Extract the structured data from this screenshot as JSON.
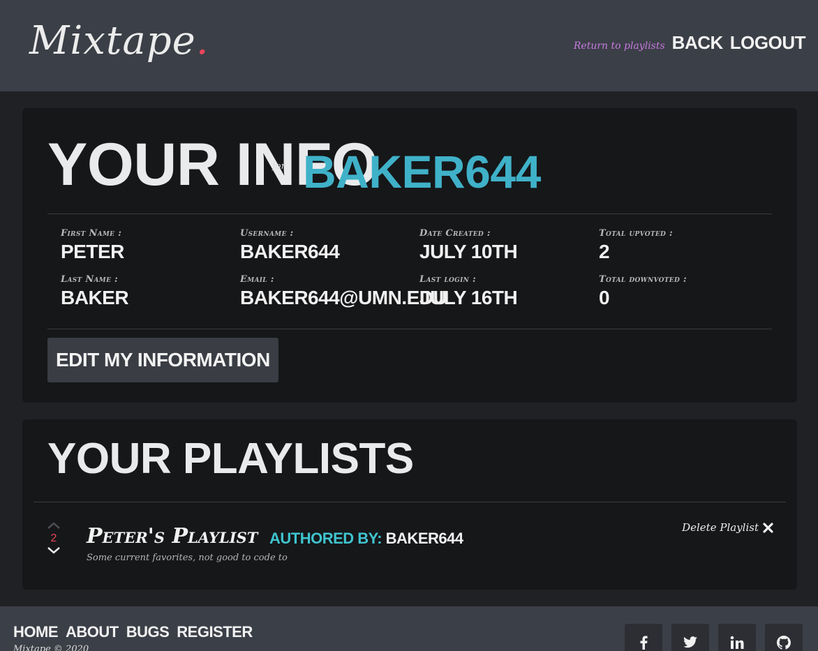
{
  "header": {
    "logo": "Mixtape",
    "logo_dot": ".",
    "return_label": "Return to playlists",
    "back_label": "BACK",
    "logout_label": "LOGOUT"
  },
  "info": {
    "title": "YOUR INFO",
    "for_label": "for",
    "username_heading": "BAKER644",
    "fields": [
      {
        "label": "First Name :",
        "value": "PETER"
      },
      {
        "label": "Username :",
        "value": "BAKER644"
      },
      {
        "label": "Date Created :",
        "value": "JULY 10TH"
      },
      {
        "label": "Total upvoted :",
        "value": "2"
      },
      {
        "label": "Last Name :",
        "value": "BAKER"
      },
      {
        "label": "Email :",
        "value": "BAKER644@UMN.EDU"
      },
      {
        "label": "Last login :",
        "value": "JULY 16TH"
      },
      {
        "label": "Total downvoted :",
        "value": "0"
      }
    ],
    "edit_button": "EDIT MY INFORMATION"
  },
  "playlists": {
    "title": "YOUR PLAYLISTS",
    "items": [
      {
        "name": "Peter's Playlist",
        "authored_label": "AUTHORED BY:",
        "author": "BAKER644",
        "description": "Some current favorites, not good to code to",
        "votes": "2",
        "delete_label": "Delete Playlist"
      }
    ]
  },
  "footer": {
    "links": [
      "HOME",
      "ABOUT",
      "BUGS",
      "REGISTER"
    ],
    "copyright": "Mixtape © 2020",
    "social": [
      "facebook-icon",
      "twitter-icon",
      "linkedin-icon",
      "github-icon"
    ]
  },
  "colors": {
    "accent_cyan": "#3fb1c8",
    "accent_red": "#e8455a",
    "accent_purple": "#c77be0"
  }
}
